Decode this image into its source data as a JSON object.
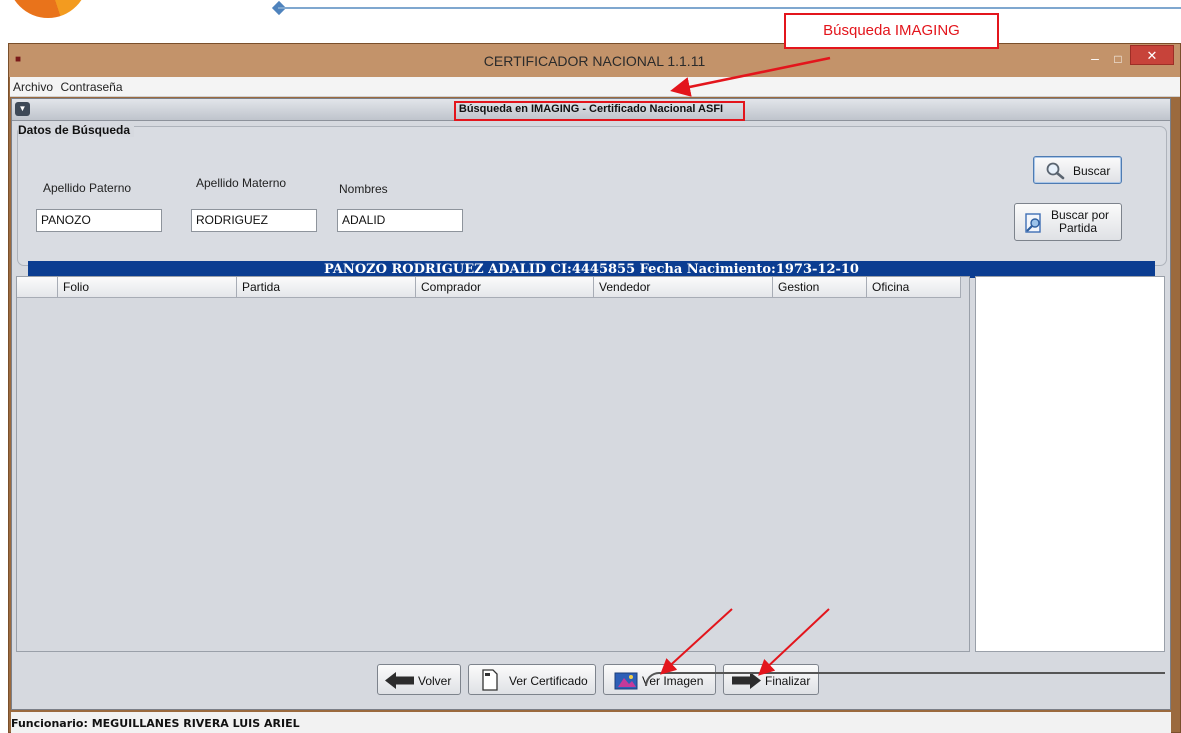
{
  "window": {
    "title": "CERTIFICADOR NACIONAL 1.1.11",
    "minimize_glyph": "–",
    "maximize_glyph": "□",
    "close_glyph": "✕"
  },
  "menu": {
    "items": [
      "Archivo",
      "Contraseña"
    ]
  },
  "panel": {
    "title": "Búsqueda en IMAGING - Certificado Nacional ASFI"
  },
  "search": {
    "legend": "Datos de Búsqueda",
    "apellido_paterno_label": "Apellido Paterno",
    "apellido_materno_label": "Apellido Materno",
    "nombres_label": "Nombres",
    "apellido_paterno_value": "PANOZO",
    "apellido_materno_value": "RODRIGUEZ",
    "nombres_value": "ADALID",
    "buscar_label": "Buscar",
    "buscar_partida_label_1": "Buscar por",
    "buscar_partida_label_2": "Partida"
  },
  "info": {
    "text": "PANOZO RODRIGUEZ ADALID CI:4445855 Fecha Nacimiento:1973-12-10"
  },
  "table": {
    "columns": [
      "",
      "Folio",
      "Partida",
      "Comprador",
      "Vendedor",
      "Gestion",
      "Oficina"
    ],
    "rows": []
  },
  "actions": {
    "volver": "Volver",
    "ver_certificado": "Ver Certificado",
    "ver_imagen": "Ver Imagen",
    "finalizar": "Finalizar"
  },
  "status": {
    "text": "Funcionario: MEGUILLANES RIVERA LUIS ARIEL"
  },
  "annotation": {
    "text": "Búsqueda IMAGING"
  },
  "colors": {
    "titlebar": "#c3936a",
    "info_strip": "#0b3d91",
    "annotation": "#e3151c"
  },
  "icons": {
    "buscar": "magnifier-icon",
    "buscar_partida": "document-search-icon",
    "volver": "arrow-left-icon",
    "ver_certificado": "document-icon",
    "ver_imagen": "image-icon",
    "finalizar": "arrow-right-icon"
  }
}
